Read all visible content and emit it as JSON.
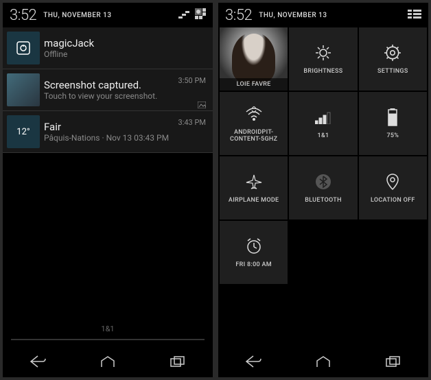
{
  "left": {
    "time": "3:52",
    "date": "THU, NOVEMBER 13",
    "notifications": [
      {
        "title": "magicJack",
        "sub": "Offline",
        "time": "",
        "icon": "magicjack"
      },
      {
        "title": "Screenshot captured.",
        "sub": "Touch to view your screenshot.",
        "time": "3:50 PM",
        "icon": "screenshot"
      },
      {
        "title": "Fair",
        "sub": "Pâquis-Nations · Nov 13  03:43 PM",
        "time": "3:43 PM",
        "icon": "weather",
        "iconText": "12°"
      }
    ],
    "carrier": "1&1"
  },
  "right": {
    "time": "3:52",
    "date": "THU, NOVEMBER 13",
    "tiles": {
      "user": "LOIE FAVRE",
      "brightness": "BRIGHTNESS",
      "settings": "SETTINGS",
      "wifi": "ANDROIDPIT-CONTENT-5GHZ",
      "signal": "1&1",
      "battery": "75%",
      "airplane": "AIRPLANE MODE",
      "bluetooth": "BLUETOOTH",
      "location": "LOCATION OFF",
      "alarm": "FRI 8:00 AM"
    }
  }
}
